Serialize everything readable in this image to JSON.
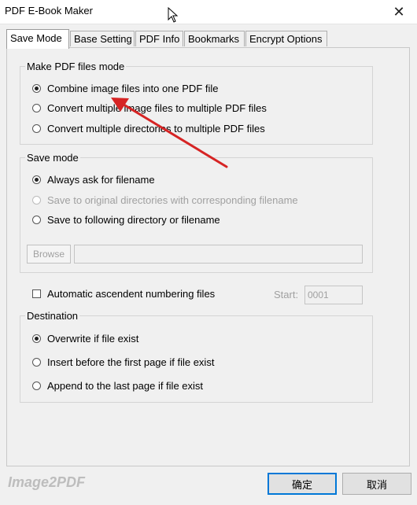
{
  "window": {
    "title": "PDF E-Book Maker",
    "close_glyph": "✕"
  },
  "tabs": [
    {
      "label": "Save Mode",
      "active": true
    },
    {
      "label": "Base Setting"
    },
    {
      "label": "PDF Info"
    },
    {
      "label": "Bookmarks"
    },
    {
      "label": "Encrypt Options"
    }
  ],
  "make_mode": {
    "legend": "Make PDF files mode",
    "options": [
      {
        "label": "Combine image files into one PDF file",
        "checked": true
      },
      {
        "label": "Convert multiple image files to multiple PDF files",
        "checked": false
      },
      {
        "label": "Convert multiple directories to multiple PDF files",
        "checked": false
      }
    ]
  },
  "save_mode": {
    "legend": "Save mode",
    "options": [
      {
        "label": "Always ask for filename",
        "checked": true
      },
      {
        "label": "Save to original directories with corresponding filename",
        "checked": false,
        "disabled": true
      },
      {
        "label": "Save to following directory or filename",
        "checked": false
      }
    ],
    "browse_label": "Browse",
    "path_value": ""
  },
  "numbering": {
    "label": "Automatic ascendent numbering files",
    "checked": false,
    "start_label": "Start:",
    "start_value": "0001"
  },
  "destination": {
    "legend": "Destination",
    "options": [
      {
        "label": "Overwrite if file exist",
        "checked": true
      },
      {
        "label": "Insert before the first page if file exist",
        "checked": false
      },
      {
        "label": "Append to the last page if file exist",
        "checked": false
      }
    ]
  },
  "footer": {
    "brand": "Image2PDF",
    "ok_label": "确定",
    "cancel_label": "取消"
  },
  "annotation": {
    "color": "#d62424"
  }
}
